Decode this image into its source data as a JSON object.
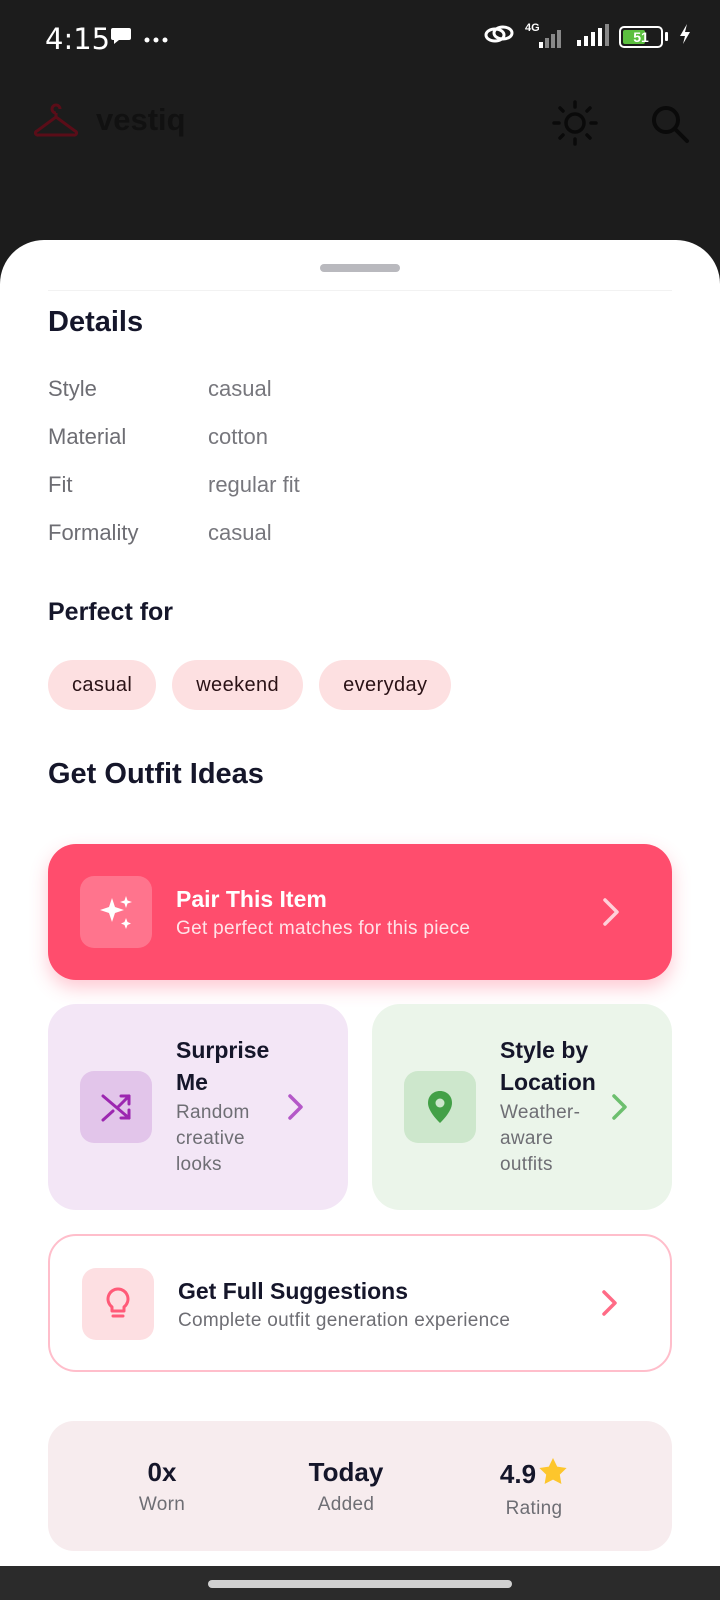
{
  "status_bar": {
    "time": "4:15",
    "network": "4G",
    "battery_level": "51"
  },
  "app_bar": {
    "title": "vestiq",
    "icons": [
      "hanger-icon",
      "sun-icon",
      "search-icon"
    ]
  },
  "details": {
    "title": "Details",
    "rows": [
      {
        "label": "Style",
        "value": "casual"
      },
      {
        "label": "Material",
        "value": "cotton"
      },
      {
        "label": "Fit",
        "value": "regular fit"
      },
      {
        "label": "Formality",
        "value": "casual"
      }
    ]
  },
  "perfect_for": {
    "title": "Perfect for",
    "tags": [
      "casual",
      "weekend",
      "everyday"
    ]
  },
  "outfit_ideas": {
    "title": "Get Outfit Ideas",
    "pair": {
      "title": "Pair This Item",
      "subtitle": "Get perfect matches for this piece",
      "icon": "sparkles-icon"
    },
    "surprise": {
      "title": "Surprise Me",
      "subtitle": "Random creative looks",
      "icon": "shuffle-icon"
    },
    "location": {
      "title": "Style by Location",
      "subtitle": "Weather-aware outfits",
      "icon": "location-pin-icon"
    },
    "full": {
      "title": "Get Full Suggestions",
      "subtitle": "Complete outfit generation experience",
      "icon": "lightbulb-icon"
    }
  },
  "stats": [
    {
      "value": "0x",
      "label": "Worn"
    },
    {
      "value": "Today",
      "label": "Added"
    },
    {
      "value": "4.9",
      "label": "Rating",
      "icon": "star-icon"
    }
  ],
  "colors": {
    "accent": "#ff4d6d",
    "chip_bg": "#fde0e1",
    "purple_card": "#f3e6f6",
    "green_card": "#ebf5ea"
  }
}
